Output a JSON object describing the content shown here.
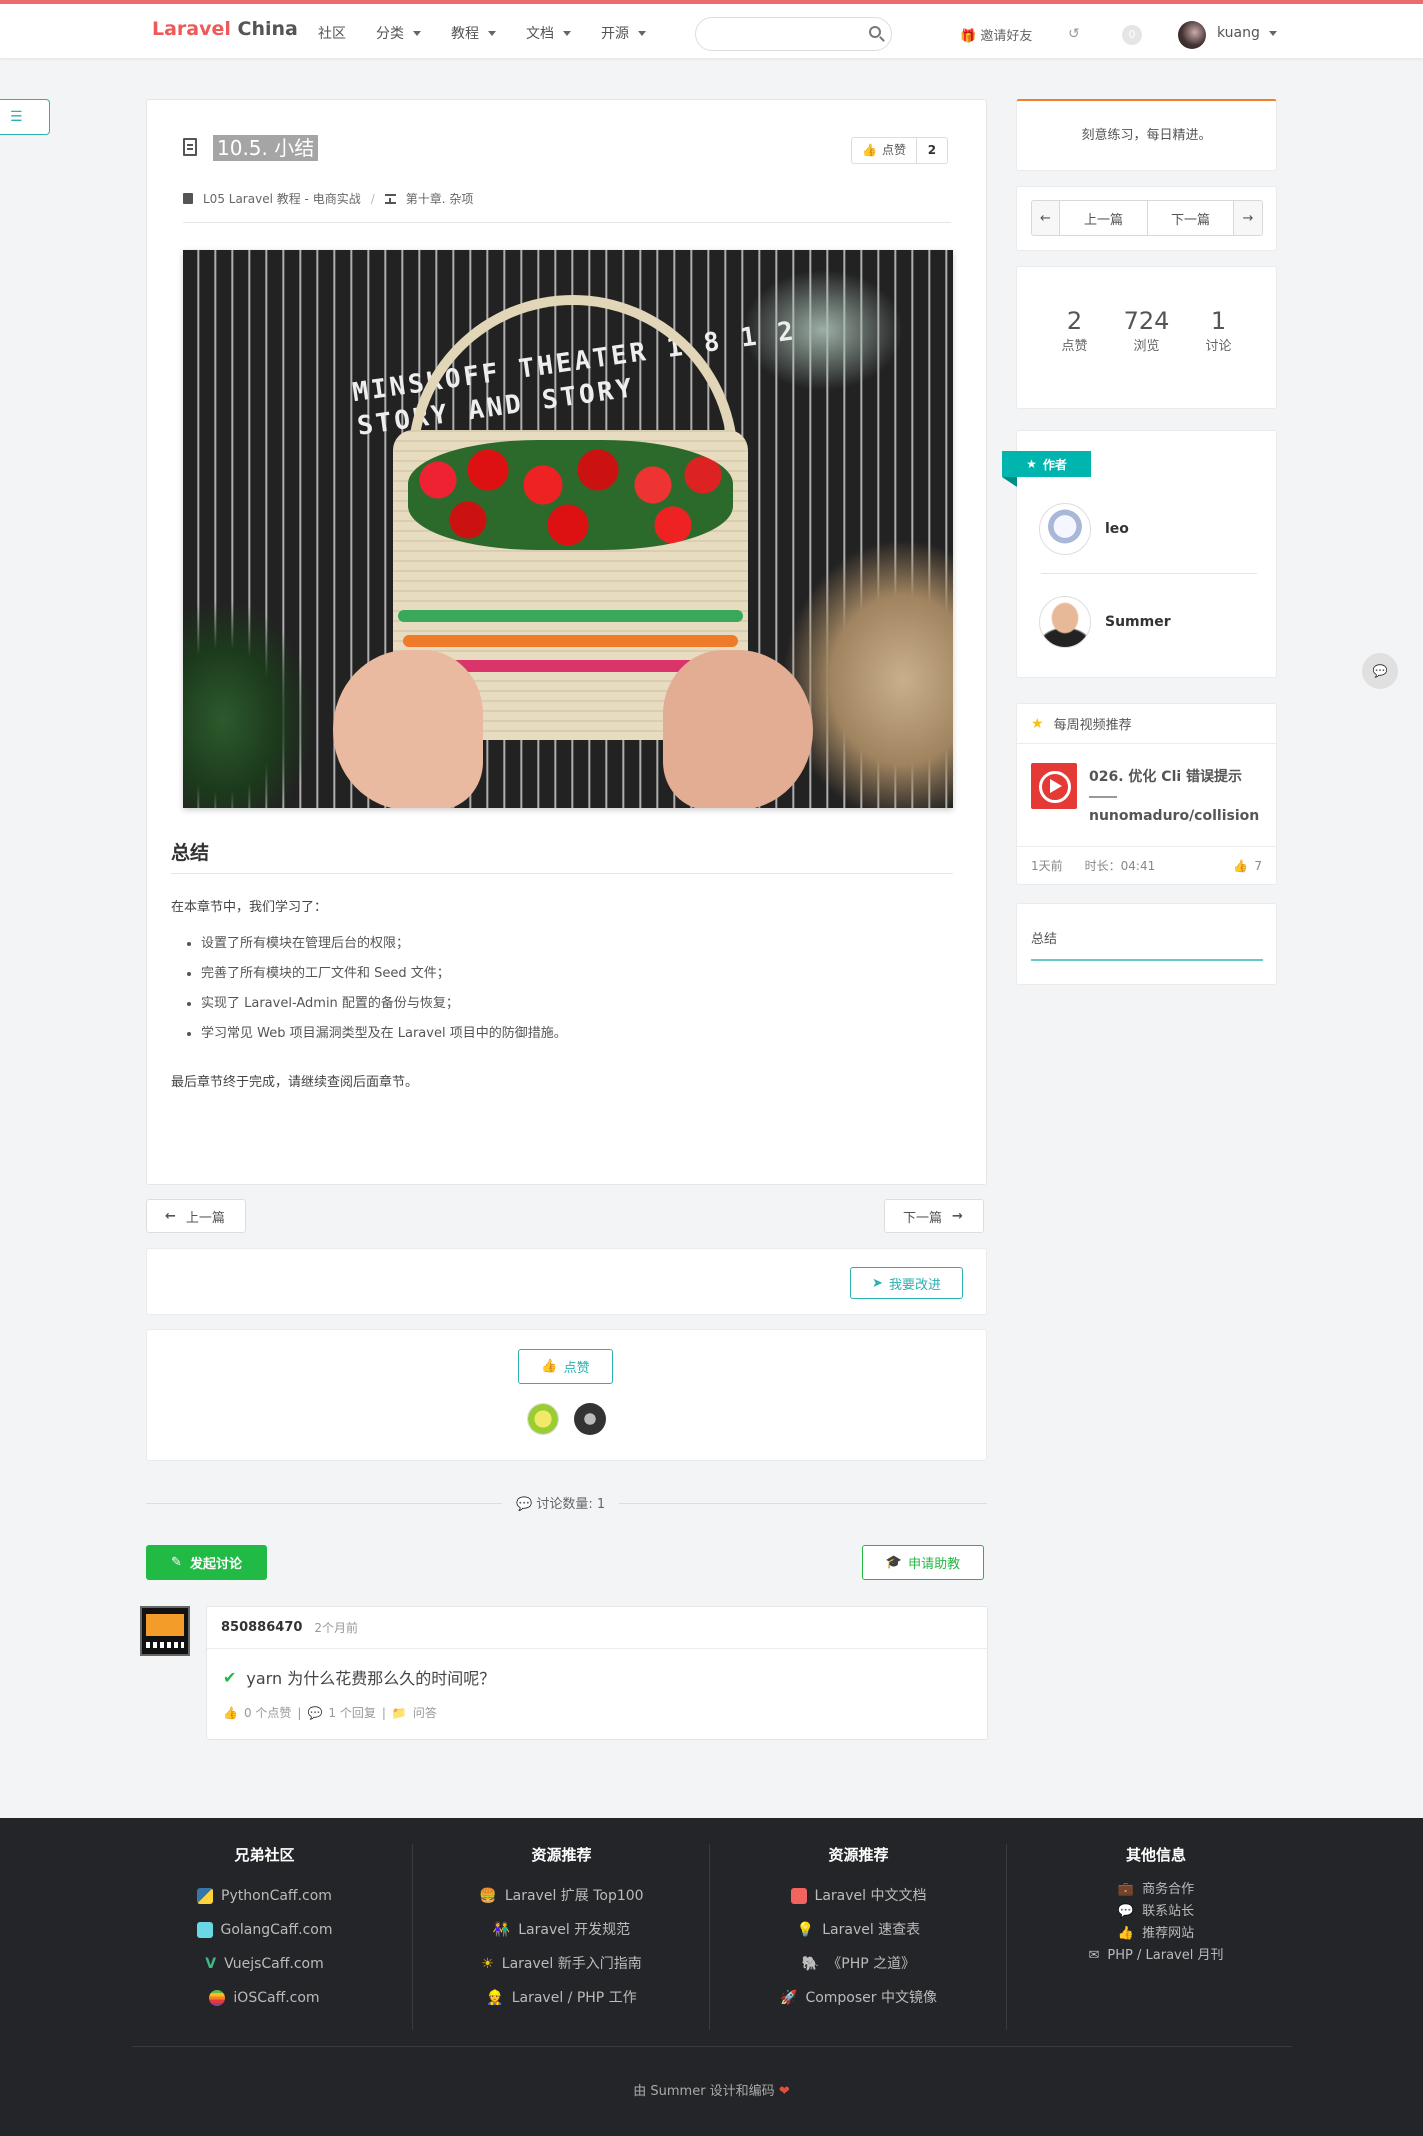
{
  "nav": {
    "logo_part1": "Laravel",
    "logo_part2": "China",
    "items": [
      "社区",
      "分类",
      "教程",
      "文档",
      "开源"
    ],
    "search_placeholder": "",
    "invite": "邀请好友",
    "notif_count": "0",
    "username": "kuang",
    "accent": "#ec6b6b"
  },
  "article": {
    "title": "10.5. 小结",
    "like_label": "点赞",
    "like_count": "2",
    "breadcrumb_book": "L05 Laravel 教程 - 电商实战",
    "breadcrumb_chapter": "第十章. 杂项",
    "photo_text_line1": "MINSKOFF THEATER 1 8 1 2",
    "photo_text_line2": "STORY AND STORY",
    "summary_heading": "总结",
    "intro": "在本章节中，我们学习了：",
    "bullets": [
      "设置了所有模块在管理后台的权限；",
      "完善了所有模块的工厂文件和 Seed 文件；",
      "实现了 Laravel-Admin 配置的备份与恢复；",
      "学习常见 Web 项目漏洞类型及在 Laravel 项目中的防御措施。"
    ],
    "closing": "最后章节终于完成，请继续查阅后面章节。"
  },
  "bottom_nav": {
    "prev": "上一篇",
    "next": "下一篇"
  },
  "improve_button": "我要改进",
  "like_button": "点赞",
  "discussion": {
    "count_label": "讨论数量:",
    "count": "1",
    "start_button": "发起讨论",
    "help_button": "申请助教",
    "comment": {
      "author": "850886470",
      "time": "2个月前",
      "title": "yarn 为什么花费那么久的时间呢？",
      "likes": "0 个点赞",
      "replies": "1 个回复",
      "category": "问答"
    }
  },
  "sidebar": {
    "motto": "刻意练习，每日精进。",
    "prev": "上一篇",
    "next": "下一篇",
    "stats": [
      {
        "num": "2",
        "label": "点赞"
      },
      {
        "num": "724",
        "label": "浏览"
      },
      {
        "num": "1",
        "label": "讨论"
      }
    ],
    "authors_label": "作者",
    "authors": [
      "leo",
      "Summer"
    ],
    "video_header": "每周视频推荐",
    "video_title": "026. 优化 Cli 错误提示",
    "video_author": "nunomaduro/collision",
    "video_time": "1天前",
    "video_duration": "时长：04:41",
    "video_likes": "7",
    "toc_item": "总结"
  },
  "footer": {
    "col1_title": "兄弟社区",
    "col1_links": [
      "PythonCaff.com",
      "GolangCaff.com",
      "VuejsCaff.com",
      "iOSCaff.com"
    ],
    "col2_title": "资源推荐",
    "col2_links": [
      "Laravel 扩展 Top100",
      "Laravel 开发规范",
      "Laravel 新手入门指南",
      "Laravel / PHP 工作"
    ],
    "col3_title": "资源推荐",
    "col3_links": [
      "Laravel 中文文档",
      "Laravel 速查表",
      "《PHP 之道》",
      "Composer 中文镜像"
    ],
    "col4_title": "其他信息",
    "col4_links": [
      "商务合作",
      "联系站长",
      "推荐网站",
      "PHP / Laravel 月刊"
    ],
    "credit": "由 Summer 设计和编码"
  }
}
